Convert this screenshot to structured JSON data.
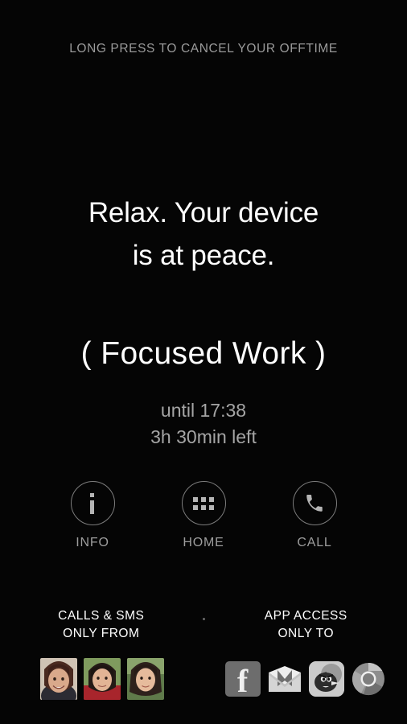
{
  "screen": {
    "background_color": "#050505",
    "top_hint": "LONG PRESS TO CANCEL YOUR OFFTIME",
    "headline_line1": "Relax. Your device",
    "headline_line2": "is at peace.",
    "profile_name": "( Focused Work )",
    "until_text": "until 17:38",
    "remaining_text": "3h 30min left"
  },
  "colors": {
    "hint_gray": "#9b9b9b",
    "headline_white": "#ffffff",
    "timing_gray": "#a5a5a5",
    "circle_stroke": "#7d7d7d",
    "action_label": "#9d9d9d"
  },
  "actions": [
    {
      "label": "INFO",
      "icon": "info-icon"
    },
    {
      "label": "HOME",
      "icon": "app-drawer-icon"
    },
    {
      "label": "CALL",
      "icon": "phone-icon"
    }
  ],
  "permissions": {
    "calls": {
      "title_line1": "CALLS & SMS",
      "title_line2": "ONLY FROM",
      "contacts": [
        {
          "name": "contact-avatar-1"
        },
        {
          "name": "contact-avatar-2"
        },
        {
          "name": "contact-avatar-3"
        }
      ]
    },
    "apps": {
      "title_line1": "APP ACCESS",
      "title_line2": "ONLY TO",
      "allowed": [
        {
          "name": "facebook-app-icon",
          "label": "Facebook"
        },
        {
          "name": "gmail-app-icon",
          "label": "Gmail"
        },
        {
          "name": "angry-birds-app-icon",
          "label": "Angry Birds"
        },
        {
          "name": "chrome-app-icon",
          "label": "Chrome"
        }
      ]
    }
  }
}
